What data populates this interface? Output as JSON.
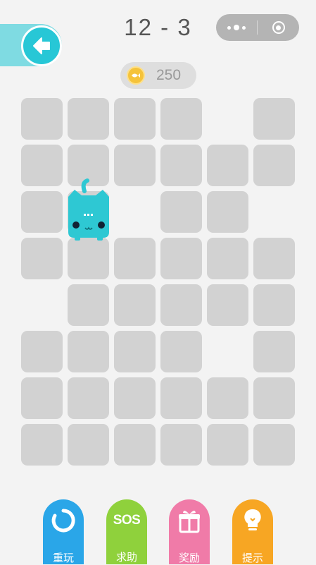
{
  "header": {
    "level": "12 - 3",
    "back_icon": "arrow-left-icon",
    "capsule": {
      "more_icon": "more-dots-icon",
      "close_icon": "target-close-icon"
    }
  },
  "coins": {
    "icon": "fish-coin-icon",
    "value": "250"
  },
  "board": {
    "rows": 8,
    "cols": 6,
    "tiles": [
      [
        1,
        1,
        1,
        1,
        0,
        1
      ],
      [
        1,
        1,
        1,
        1,
        1,
        1
      ],
      [
        1,
        1,
        0,
        1,
        1,
        0
      ],
      [
        1,
        1,
        1,
        1,
        1,
        1
      ],
      [
        0,
        1,
        1,
        1,
        1,
        1
      ],
      [
        1,
        1,
        1,
        1,
        0,
        1
      ],
      [
        1,
        1,
        1,
        1,
        1,
        1
      ],
      [
        1,
        1,
        1,
        1,
        1,
        1
      ]
    ],
    "cat": {
      "row": 2,
      "col": 1,
      "color": "#2ec8d3",
      "icon": "cat-icon"
    }
  },
  "toolbar": {
    "items": [
      {
        "label": "重玩",
        "icon": "restart-icon",
        "color": "#2aa6e8"
      },
      {
        "label": "求助",
        "icon": "sos-icon",
        "text": "SOS",
        "color": "#8fd13c"
      },
      {
        "label": "奖励",
        "icon": "gift-icon",
        "color": "#f07ba8"
      },
      {
        "label": "提示",
        "icon": "lightbulb-icon",
        "color": "#f7a623"
      }
    ]
  }
}
